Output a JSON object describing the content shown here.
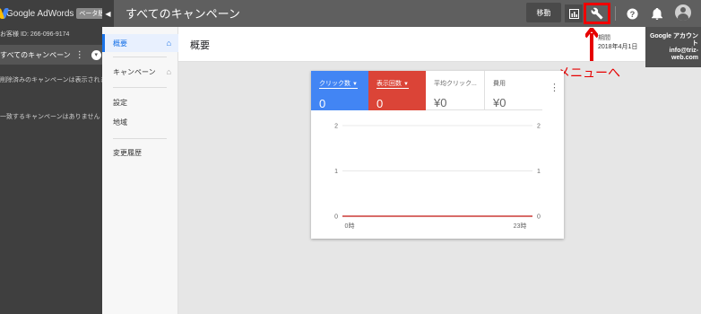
{
  "app": {
    "name": "Google AdWords",
    "badge": "ベータ版"
  },
  "sidebar": {
    "customer_id": "お客様 ID: 266-096-9174",
    "campaign_scope": "すべてのキャンペーン",
    "deleted_note": "削除済みのキャンペーンは表示されま",
    "match_note": "一致するキャンペーンはありません"
  },
  "topbar": {
    "title": "すべてのキャンペーン",
    "move_label": "移動"
  },
  "account": {
    "line1": "Google アカウン",
    "line2": "ト",
    "line3": "info@triz-",
    "line4": "web.com"
  },
  "nav": {
    "overview": "概要",
    "campaigns": "キャンペーン",
    "settings": "設定",
    "locations": "地域",
    "history": "変更履歴"
  },
  "main": {
    "title": "概要",
    "period_label": "期間",
    "period_date": "2018年4月1日"
  },
  "annotation": {
    "text": "メニューへ",
    "color": "#e60000"
  },
  "metrics": [
    {
      "label": "クリック数",
      "value": "0",
      "color": "#4285f4"
    },
    {
      "label": "表示回数",
      "value": "0",
      "color": "#db4437"
    },
    {
      "label": "平均クリック...",
      "value": "¥0"
    },
    {
      "label": "費用",
      "value": "¥0"
    }
  ],
  "chart_data": {
    "type": "line",
    "x_start_label": "0時",
    "x_end_label": "23時",
    "y_ticks": [
      "0",
      "1",
      "2"
    ],
    "ylim": [
      0,
      2
    ],
    "series": [
      {
        "name": "クリック数",
        "color": "#4285f4",
        "values": [
          0,
          0
        ]
      },
      {
        "name": "表示回数",
        "color": "#db4437",
        "values": [
          0,
          0
        ]
      }
    ]
  }
}
